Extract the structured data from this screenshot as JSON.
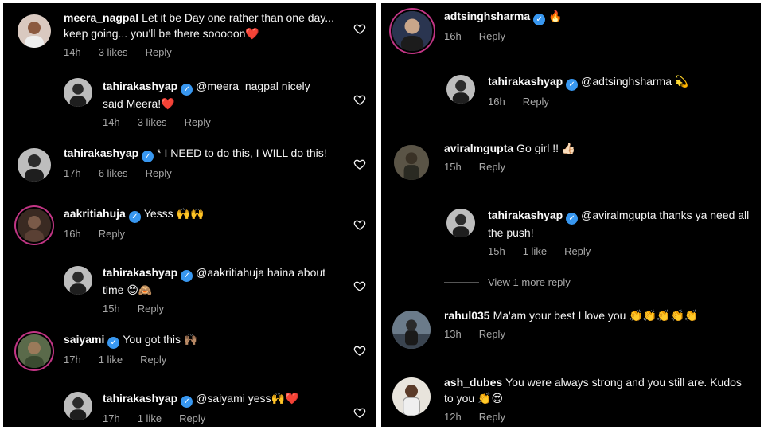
{
  "left": {
    "comments": [
      {
        "username": "meera_nagpal",
        "verified": false,
        "text": "Let it be Day one rather than one day... keep going... you'll be there sooooon❤️",
        "time": "14h",
        "likes": "3 likes",
        "reply": "Reply"
      },
      {
        "username": "tahirakashyap",
        "verified": true,
        "text": "@meera_nagpal nicely said Meera!❤️",
        "time": "14h",
        "likes": "3 likes",
        "reply": "Reply"
      },
      {
        "username": "tahirakashyap",
        "verified": true,
        "text": "* I NEED to do this, I WILL do this!",
        "time": "17h",
        "likes": "6 likes",
        "reply": "Reply"
      },
      {
        "username": "aakritiahuja",
        "verified": true,
        "text": "Yesss 🙌🙌",
        "time": "16h",
        "likes": "",
        "reply": "Reply"
      },
      {
        "username": "tahirakashyap",
        "verified": true,
        "text": "@aakritiahuja haina about time 😊🙈",
        "time": "15h",
        "likes": "",
        "reply": "Reply"
      },
      {
        "username": "saiyami",
        "verified": true,
        "text": "You got this 🙌🏽",
        "time": "17h",
        "likes": "1 like",
        "reply": "Reply"
      },
      {
        "username": "tahirakashyap",
        "verified": true,
        "text": "@saiyami yess🙌❤️",
        "time": "17h",
        "likes": "1 like",
        "reply": "Reply"
      }
    ]
  },
  "right": {
    "comments": [
      {
        "username": "adtsinghsharma",
        "verified": true,
        "text": "🔥",
        "time": "16h",
        "likes": "",
        "reply": "Reply"
      },
      {
        "username": "tahirakashyap",
        "verified": true,
        "text": "@adtsinghsharma 💫",
        "time": "16h",
        "likes": "",
        "reply": "Reply"
      },
      {
        "username": "aviralmgupta",
        "verified": false,
        "text": "Go girl !! 👍🏻",
        "time": "15h",
        "likes": "",
        "reply": "Reply"
      },
      {
        "username": "tahirakashyap",
        "verified": true,
        "text": "@aviralmgupta thanks ya need all the push!",
        "time": "15h",
        "likes": "1 like",
        "reply": "Reply"
      },
      {
        "username": "rahul035",
        "verified": false,
        "text": "Ma'am your best I love you 👏👏👏👏👏",
        "time": "13h",
        "likes": "",
        "reply": "Reply"
      },
      {
        "username": "ash_dubes",
        "verified": false,
        "text": "You were always strong and you still are. Kudos to you 👏😍",
        "time": "12h",
        "likes": "",
        "reply": "Reply"
      }
    ],
    "view_more": "View 1 more reply"
  },
  "icons": {
    "heart": "heart-outline-icon",
    "verified": "verified-badge-icon"
  },
  "colors": {
    "background": "#000000",
    "meta": "#a8a8a8",
    "verified": "#3897f0",
    "story_ring": "#c13584"
  }
}
